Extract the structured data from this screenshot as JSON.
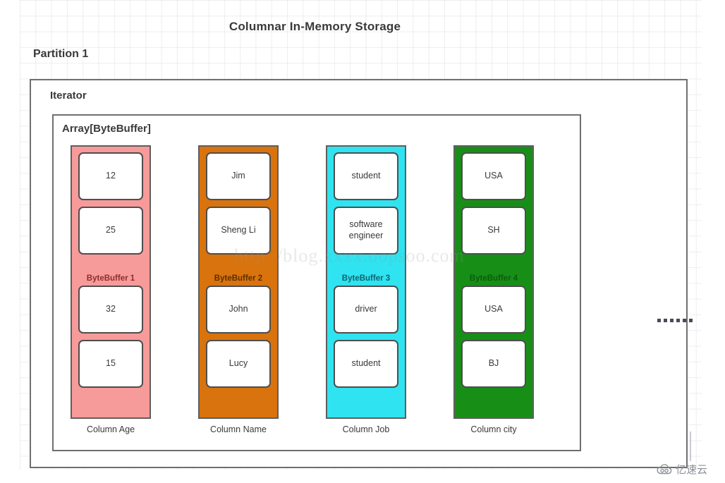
{
  "title": "Columnar In-Memory Storage",
  "partition_label": "Partition 1",
  "iterator_label": "Iterator",
  "array_label": "Array[ByteBuffer]",
  "watermark": "http://blog.xxxx.oopsoo.com",
  "ellipsis_dots": 6,
  "logo": {
    "text": "亿速云",
    "icon": "cloud-icon"
  },
  "colors": {
    "pink": "#f79a9a",
    "orange": "#d9730d",
    "cyan": "#2fe3f0",
    "green": "#178f17",
    "box_border": "#6f6f6f",
    "cell_border": "#4e4e4e",
    "text": "#3a3a3a"
  },
  "columns": [
    {
      "caption": "Column Age",
      "buffer_name": "ByteBuffer 1",
      "color": "#f79a9a",
      "name_color": "#8c2f2f",
      "cells": [
        "12",
        "25",
        "32",
        "15"
      ]
    },
    {
      "caption": "Column Name",
      "buffer_name": "ByteBuffer 2",
      "color": "#d9730d",
      "name_color": "#5c3000",
      "cells": [
        "Jim",
        "Sheng Li",
        "John",
        "Lucy"
      ]
    },
    {
      "caption": "Column Job",
      "buffer_name": "ByteBuffer 3",
      "color": "#2fe3f0",
      "name_color": "#0f6470",
      "cells": [
        "student",
        "software engineer",
        "driver",
        "student"
      ]
    },
    {
      "caption": "Column city",
      "buffer_name": "ByteBuffer 4",
      "color": "#178f17",
      "name_color": "#0d5c0d",
      "cells": [
        "USA",
        "SH",
        "USA",
        "BJ"
      ]
    }
  ]
}
